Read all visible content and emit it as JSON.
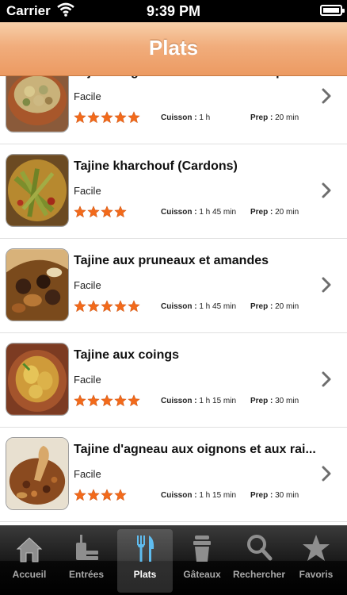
{
  "status_bar": {
    "carrier": "Carrier",
    "time": "9:39 PM"
  },
  "nav": {
    "title": "Plats"
  },
  "labels": {
    "cook": "Cuisson :",
    "prep": "Prep :"
  },
  "colors": {
    "accent": "#ec9a62",
    "star": "#f26a1b"
  },
  "recipes": [
    {
      "name": "Tajine d'agneau aux artichauts et petit...",
      "difficulty": "Facile",
      "rating": 5,
      "cook_time": "1 h",
      "prep_time": "20 min",
      "image_icon": "tajine-artichauts-photo"
    },
    {
      "name": "Tajine kharchouf (Cardons)",
      "difficulty": "Facile",
      "rating": 4,
      "cook_time": "1 h 45 min",
      "prep_time": "20 min",
      "image_icon": "tajine-cardons-photo"
    },
    {
      "name": "Tajine aux pruneaux et amandes",
      "difficulty": "Facile",
      "rating": 5,
      "cook_time": "1 h 45 min",
      "prep_time": "20 min",
      "image_icon": "tajine-pruneaux-photo"
    },
    {
      "name": "Tajine aux coings",
      "difficulty": "Facile",
      "rating": 5,
      "cook_time": "1 h 15 min",
      "prep_time": "30 min",
      "image_icon": "tajine-coings-photo"
    },
    {
      "name": "Tajine d'agneau aux oignons et aux rai...",
      "difficulty": "Facile",
      "rating": 4,
      "cook_time": "1 h 15 min",
      "prep_time": "30 min",
      "image_icon": "tajine-oignons-photo"
    }
  ],
  "tabs": [
    {
      "label": "Accueil",
      "icon": "home-icon",
      "active": false
    },
    {
      "label": "Entrées",
      "icon": "drink-plate-icon",
      "active": false
    },
    {
      "label": "Plats",
      "icon": "fork-knife-icon",
      "active": true
    },
    {
      "label": "Gâteaux",
      "icon": "cake-icon",
      "active": false
    },
    {
      "label": "Rechercher",
      "icon": "search-icon",
      "active": false
    },
    {
      "label": "Favoris",
      "icon": "star-icon",
      "active": false
    }
  ]
}
